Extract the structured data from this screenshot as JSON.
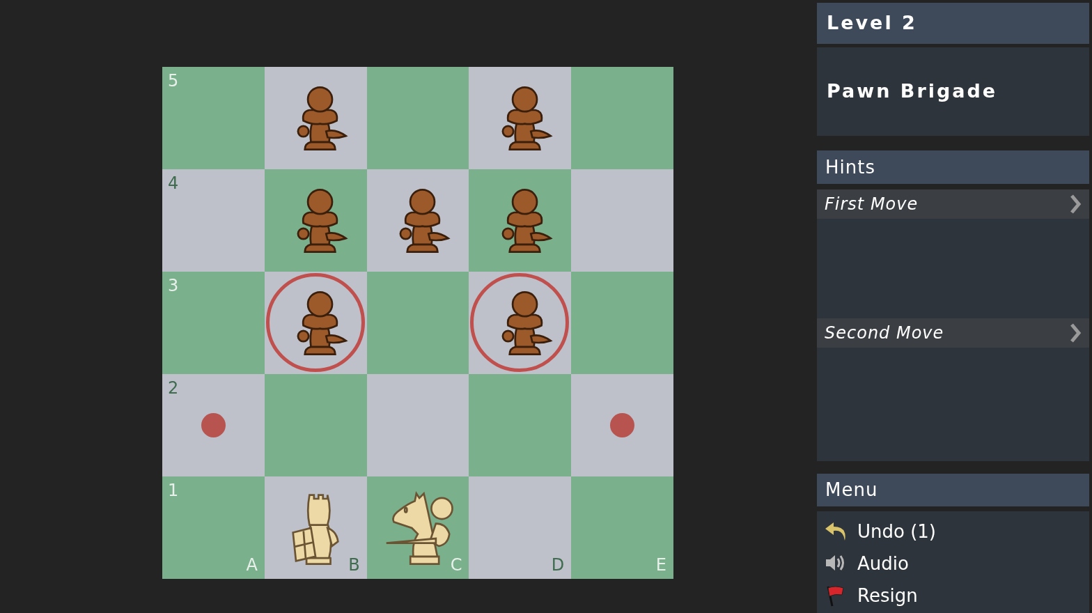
{
  "board": {
    "rank_labels": [
      "5",
      "4",
      "3",
      "2",
      "1"
    ],
    "file_labels": [
      "A",
      "B",
      "C",
      "D",
      "E"
    ],
    "rows": [
      {
        "cells": [
          {
            "kind": "empty",
            "highlighted": false
          },
          {
            "kind": "black-pawn",
            "highlighted": false
          },
          {
            "kind": "empty",
            "highlighted": false
          },
          {
            "kind": "black-pawn",
            "highlighted": false
          },
          {
            "kind": "empty",
            "highlighted": false
          }
        ]
      },
      {
        "cells": [
          {
            "kind": "empty",
            "highlighted": false
          },
          {
            "kind": "black-pawn",
            "highlighted": false
          },
          {
            "kind": "black-pawn",
            "highlighted": false
          },
          {
            "kind": "black-pawn",
            "highlighted": false
          },
          {
            "kind": "empty",
            "highlighted": false
          }
        ]
      },
      {
        "cells": [
          {
            "kind": "empty",
            "highlighted": false
          },
          {
            "kind": "black-pawn",
            "highlighted": true
          },
          {
            "kind": "empty",
            "highlighted": false
          },
          {
            "kind": "black-pawn",
            "highlighted": true
          },
          {
            "kind": "empty",
            "highlighted": false
          }
        ]
      },
      {
        "cells": [
          {
            "kind": "move-dot",
            "highlighted": false
          },
          {
            "kind": "empty",
            "highlighted": false
          },
          {
            "kind": "empty",
            "highlighted": false
          },
          {
            "kind": "empty",
            "highlighted": false
          },
          {
            "kind": "move-dot",
            "highlighted": false
          }
        ]
      },
      {
        "cells": [
          {
            "kind": "empty",
            "highlighted": false
          },
          {
            "kind": "white-rook",
            "highlighted": false
          },
          {
            "kind": "white-knight",
            "highlighted": false
          },
          {
            "kind": "empty",
            "highlighted": false
          },
          {
            "kind": "empty",
            "highlighted": false
          }
        ]
      }
    ]
  },
  "level": {
    "header": "Level 2",
    "title": "Pawn Brigade"
  },
  "hints": {
    "header": "Hints",
    "items": [
      {
        "label": "First Move"
      },
      {
        "label": "Second Move"
      }
    ]
  },
  "menu": {
    "header": "Menu",
    "items": [
      {
        "kind": "undo",
        "label": "Undo (1)"
      },
      {
        "kind": "audio",
        "label": "Audio"
      },
      {
        "kind": "resign",
        "label": "Resign"
      }
    ]
  }
}
